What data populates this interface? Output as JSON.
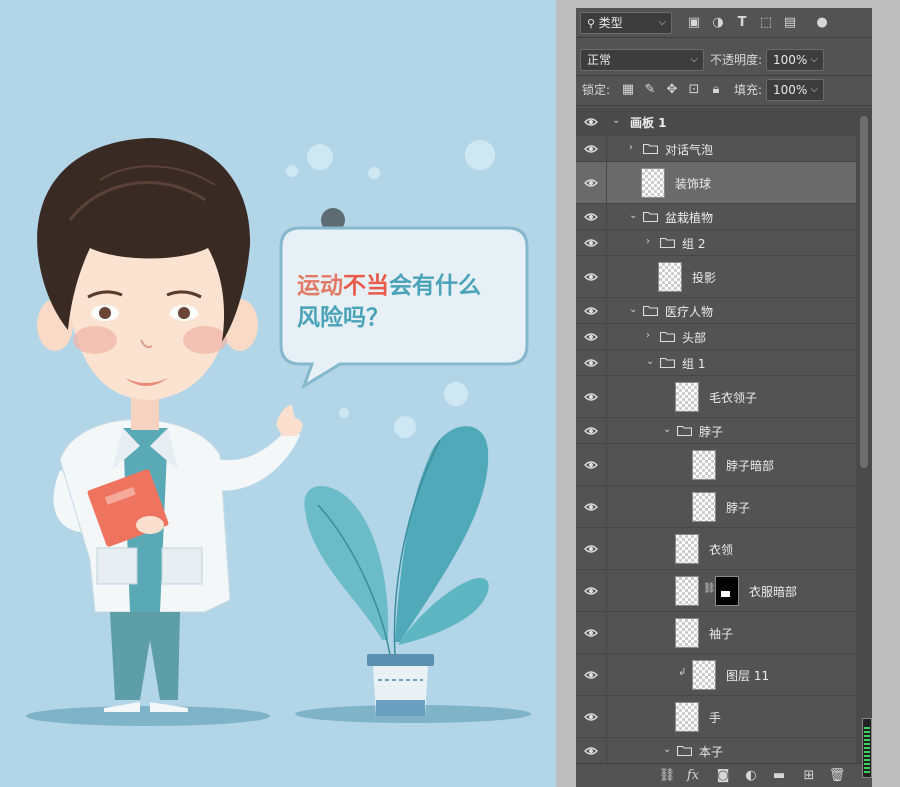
{
  "canvas": {
    "bubble": {
      "line1_a": "运动",
      "line1_b": "不当",
      "line1_c": "会有什么",
      "line2": "风险吗？"
    },
    "colors": {
      "bg": "#b3d5e8",
      "accent_red": "#e17a64",
      "accent_blue": "#4aa3b9"
    }
  },
  "panel": {
    "filter": {
      "kind_label": "类型",
      "icons": [
        "image-filter-icon",
        "adjustment-filter-icon",
        "type-filter-icon",
        "shape-filter-icon",
        "smart-object-filter-icon",
        "filter-toggle-icon"
      ]
    },
    "blend": {
      "mode": "正常",
      "opacity_label": "不透明度:",
      "opacity_value": "100%"
    },
    "lock": {
      "label": "锁定:",
      "fill_label": "填充:",
      "fill_value": "100%"
    },
    "layers": [
      {
        "name": "画板 1",
        "type": "artboard",
        "indent": 0,
        "expanded": true
      },
      {
        "name": "对话气泡",
        "type": "group",
        "indent": 1,
        "expanded": false
      },
      {
        "name": "装饰球",
        "type": "layer",
        "indent": 1,
        "selected": true
      },
      {
        "name": "盆栽植物",
        "type": "group",
        "indent": 1,
        "expanded": true
      },
      {
        "name": "组 2",
        "type": "group",
        "indent": 2,
        "expanded": false
      },
      {
        "name": "投影",
        "type": "layer",
        "indent": 2
      },
      {
        "name": "医疗人物",
        "type": "group",
        "indent": 1,
        "expanded": true
      },
      {
        "name": "头部",
        "type": "group",
        "indent": 2,
        "expanded": false
      },
      {
        "name": "组 1",
        "type": "group",
        "indent": 2,
        "expanded": true
      },
      {
        "name": "毛衣领子",
        "type": "layer",
        "indent": 3
      },
      {
        "name": "脖子",
        "type": "group",
        "indent": 3,
        "expanded": true
      },
      {
        "name": "脖子暗部",
        "type": "layer",
        "indent": 4
      },
      {
        "name": "脖子",
        "type": "layer",
        "indent": 4
      },
      {
        "name": "衣领",
        "type": "layer",
        "indent": 3
      },
      {
        "name": "衣服暗部",
        "type": "layer",
        "indent": 3,
        "mask": true
      },
      {
        "name": "袖子",
        "type": "layer",
        "indent": 3
      },
      {
        "name": "图层 11",
        "type": "layer",
        "indent": 4,
        "clipped": true
      },
      {
        "name": "手",
        "type": "layer",
        "indent": 3
      },
      {
        "name": "本子",
        "type": "group",
        "indent": 3,
        "expanded": true
      }
    ],
    "bottom_icons": [
      "link-layers-icon",
      "fx-icon",
      "add-mask-icon",
      "adjustment-layer-icon",
      "new-group-icon",
      "new-layer-icon",
      "delete-layer-icon"
    ]
  }
}
